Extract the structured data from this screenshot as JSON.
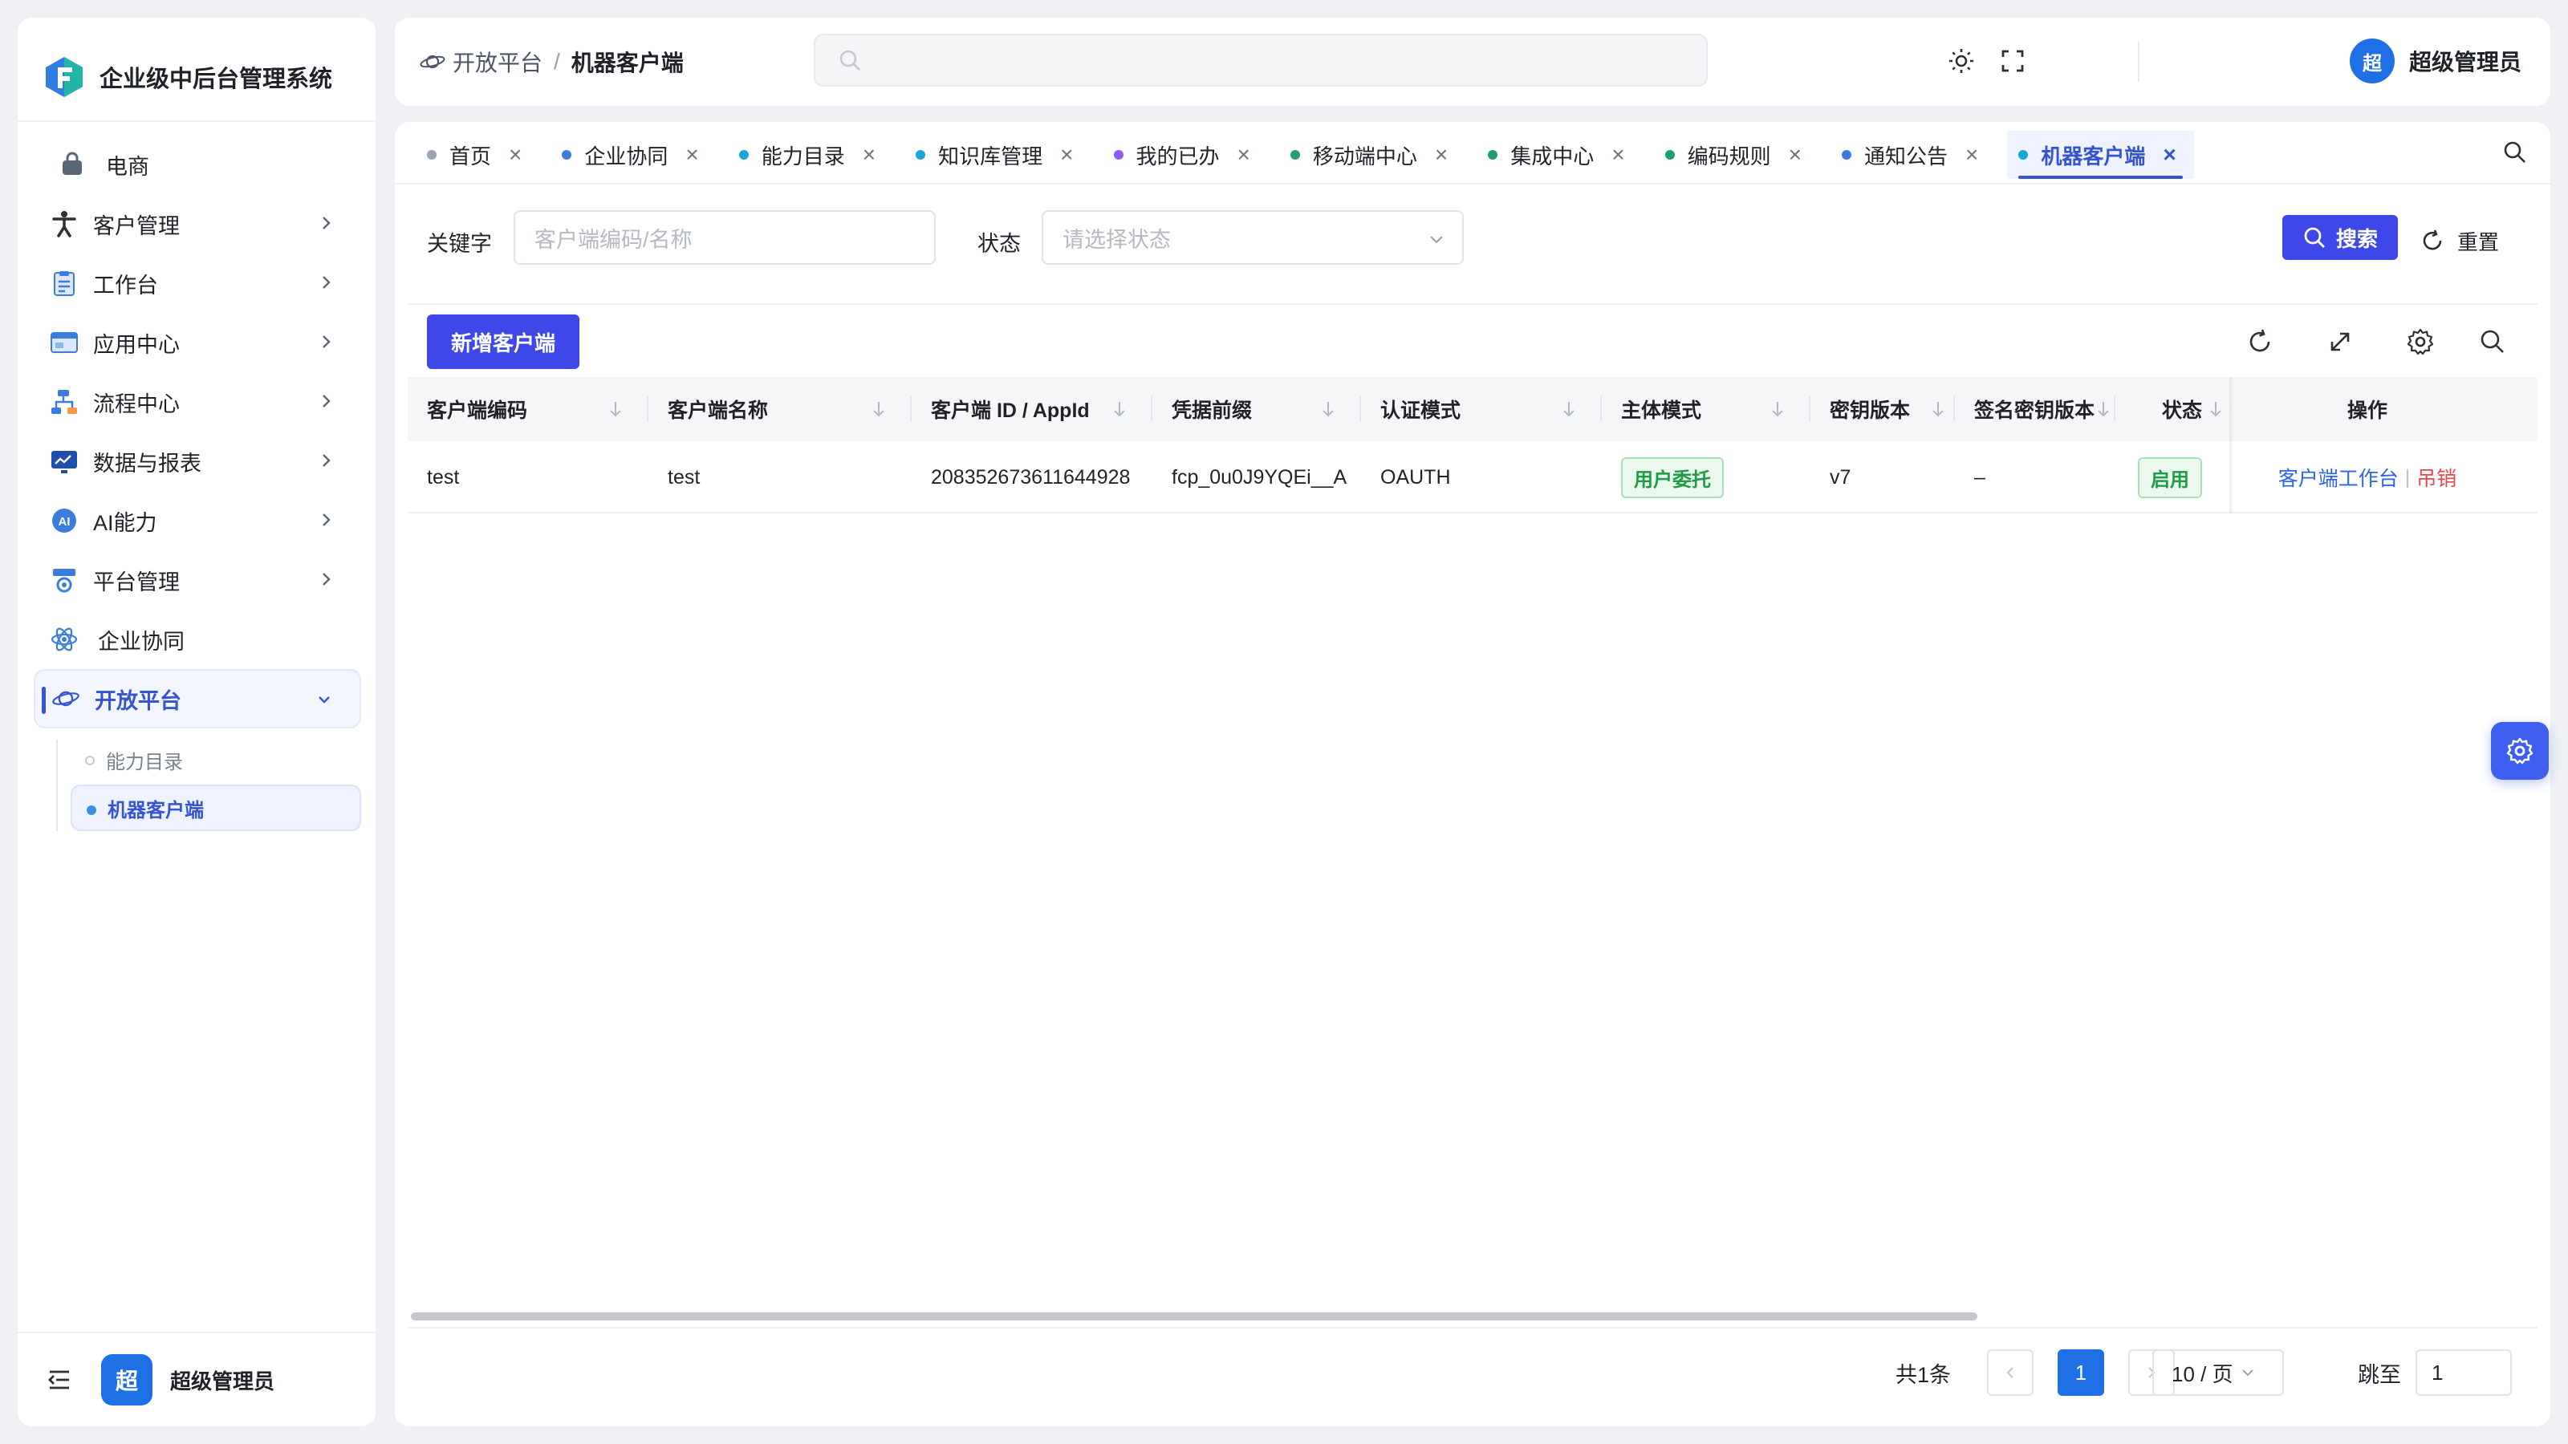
{
  "app": {
    "title": "企业级中后台管理系统"
  },
  "sidebar": {
    "items": [
      {
        "label": "电商",
        "icon": "bag-icon",
        "has_children": false
      },
      {
        "label": "客户管理",
        "icon": "person-icon",
        "has_children": true
      },
      {
        "label": "工作台",
        "icon": "clipboard-icon",
        "has_children": true
      },
      {
        "label": "应用中心",
        "icon": "app-window-icon",
        "has_children": true
      },
      {
        "label": "流程中心",
        "icon": "flow-icon",
        "has_children": true
      },
      {
        "label": "数据与报表",
        "icon": "chart-screen-icon",
        "has_children": true
      },
      {
        "label": "AI能力",
        "icon": "ai-icon",
        "has_children": true
      },
      {
        "label": "平台管理",
        "icon": "platform-gear-icon",
        "has_children": true
      },
      {
        "label": "企业协同",
        "icon": "atom-icon",
        "has_children": false
      },
      {
        "label": "开放平台",
        "icon": "planet-icon",
        "has_children": true,
        "expanded": true,
        "active": true
      }
    ],
    "submenu": [
      {
        "label": "能力目录",
        "active": false
      },
      {
        "label": "机器客户端",
        "active": true
      }
    ],
    "footer_user": {
      "avatar_text": "超",
      "name": "超级管理员"
    }
  },
  "header": {
    "breadcrumb": {
      "parent": "开放平台",
      "separator": "/",
      "current": "机器客户端"
    },
    "search": {
      "placeholder": ""
    },
    "user": {
      "avatar_text": "超",
      "name": "超级管理员"
    }
  },
  "tabs": [
    {
      "label": "首页",
      "dot_color": "#9aa3b2",
      "active": false
    },
    {
      "label": "企业协同",
      "dot_color": "#3b7ddd",
      "active": false
    },
    {
      "label": "能力目录",
      "dot_color": "#1ba4d6",
      "active": false
    },
    {
      "label": "知识库管理",
      "dot_color": "#1ba4d6",
      "active": false
    },
    {
      "label": "我的已办",
      "dot_color": "#8b5cf6",
      "active": false
    },
    {
      "label": "移动端中心",
      "dot_color": "#22a06b",
      "active": false
    },
    {
      "label": "集成中心",
      "dot_color": "#22a06b",
      "active": false
    },
    {
      "label": "编码规则",
      "dot_color": "#22a06b",
      "active": false
    },
    {
      "label": "通知公告",
      "dot_color": "#3b7ddd",
      "active": false
    },
    {
      "label": "机器客户端",
      "dot_color": "#1ba4d6",
      "active": true
    }
  ],
  "filters": {
    "keyword_label": "关键字",
    "keyword_placeholder": "客户端编码/名称",
    "status_label": "状态",
    "status_placeholder": "请选择状态",
    "search_button": "搜索",
    "reset_button": "重置"
  },
  "toolbar": {
    "add_button": "新增客户端"
  },
  "table": {
    "columns": [
      "客户端编码",
      "客户端名称",
      "客户端 ID / AppId",
      "凭据前缀",
      "认证模式",
      "主体模式",
      "密钥版本",
      "签名密钥版本",
      "状态",
      "操作"
    ],
    "rows": [
      {
        "code": "test",
        "name": "test",
        "app_id": "208352673611644928",
        "prefix": "fcp_0u0J9YQEi__A",
        "auth_mode": "OAUTH",
        "subject_mode": "用户委托",
        "key_version": "v7",
        "sign_key_version": "–",
        "status": "启用",
        "actions": {
          "workbench": "客户端工作台",
          "separator": "|",
          "revoke": "吊销"
        }
      }
    ]
  },
  "pagination": {
    "total_text": "共1条",
    "current_page": "1",
    "page_size": "10 / 页",
    "jump_label": "跳至",
    "jump_value": "1"
  },
  "colors": {
    "primary": "#3e48e8",
    "link": "#2e62e8",
    "danger": "#e5484d",
    "success": "#1f9a45"
  }
}
